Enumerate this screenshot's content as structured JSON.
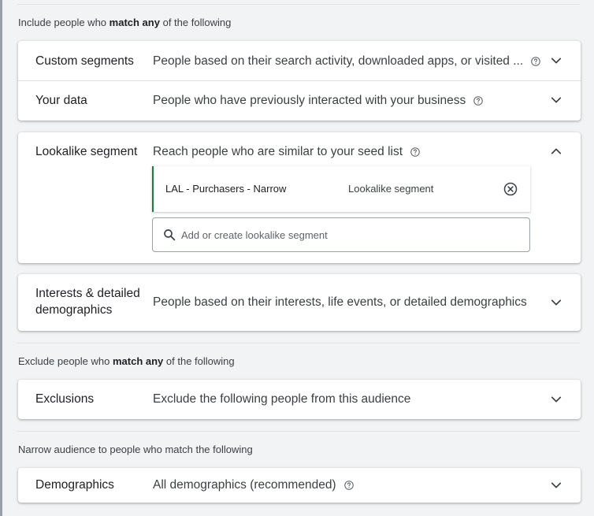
{
  "include": {
    "heading_prefix": "Include people who",
    "heading_bold": "match any",
    "heading_suffix": "of the following",
    "rows": [
      {
        "title": "Custom segments",
        "description": "People based on their search activity, downloaded apps, or visited ...",
        "has_help": true
      },
      {
        "title": "Your data",
        "description": "People who have previously interacted with your business",
        "has_help": true
      }
    ],
    "lookalike": {
      "title": "Lookalike segment",
      "description": "Reach people who are similar to your seed list",
      "selected_segment": {
        "name": "LAL - Purchasers - Narrow",
        "type": "Lookalike segment"
      },
      "search": {
        "placeholder": "Add or create lookalike segment",
        "value": ""
      }
    },
    "interests": {
      "title": "Interests & detailed demographics",
      "description": "People based on their interests, life events, or detailed demographics"
    }
  },
  "exclude": {
    "heading_prefix": "Exclude people who",
    "heading_bold": "match any",
    "heading_suffix": "of the following",
    "row": {
      "title": "Exclusions",
      "description": "Exclude the following people from this audience"
    }
  },
  "narrow": {
    "heading": "Narrow audience to people who match the following",
    "row": {
      "title": "Demographics",
      "description": "All demographics (recommended)",
      "has_help": true
    }
  },
  "colors": {
    "background": "#f1f3f4",
    "card": "#ffffff",
    "selected_accent": "#188038",
    "text_primary": "#202124",
    "text_secondary": "#3c4043",
    "icon": "#5f6368"
  },
  "icons": {
    "help": "help-circle-icon",
    "expand": "chevron-down-icon",
    "collapse": "chevron-up-icon",
    "remove": "cancel-circle-icon",
    "search": "search-icon"
  }
}
